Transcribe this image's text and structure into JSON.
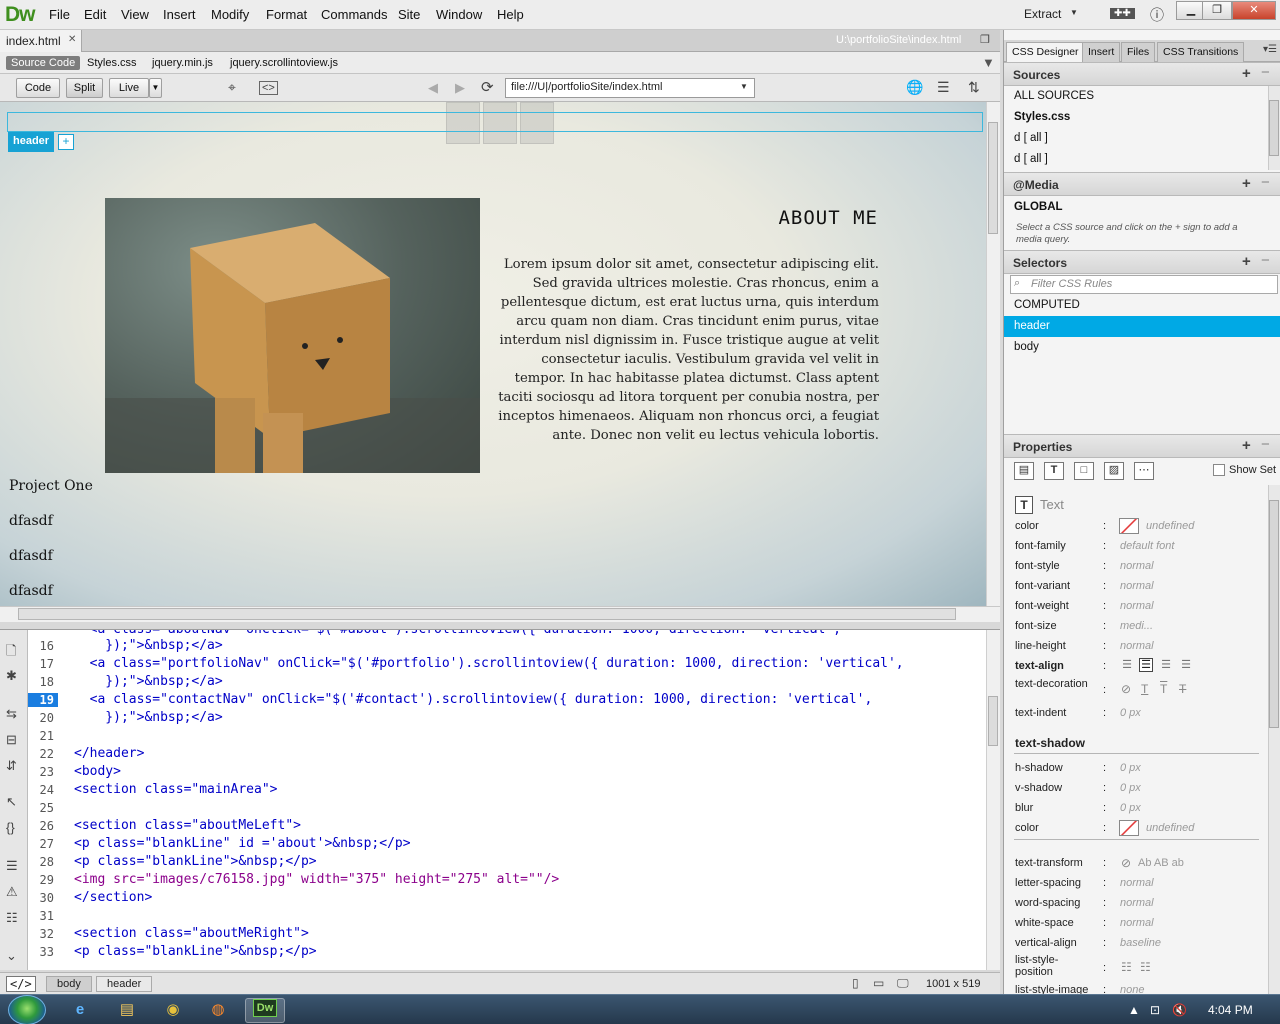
{
  "app": {
    "logo": "Dw",
    "menu": [
      "File",
      "Edit",
      "View",
      "Insert",
      "Modify",
      "Format",
      "Commands",
      "Site",
      "Window",
      "Help"
    ],
    "workspace": "Extract"
  },
  "document": {
    "tab": "index.html",
    "path": "U:\\portfolioSite\\index.html",
    "related_files": [
      "Source Code",
      "Styles.css",
      "jquery.min.js",
      "jquery.scrollintoview.js"
    ],
    "views": [
      "Code",
      "Split",
      "Live"
    ],
    "address": "file:///U|/portfolioSite/index.html"
  },
  "design": {
    "badge": "header",
    "badge_plus": "+",
    "about_title": "ABOUT ME",
    "about_text": "Lorem ipsum dolor sit amet, consectetur adipiscing elit. Sed gravida ultrices molestie. Cras rhoncus, enim a pellentesque dictum, est erat luctus urna, quis interdum arcu quam non diam. Cras tincidunt enim purus, vitae interdum nisl dignissim in. Fusce tristique augue at velit consectetur iaculis. Vestibulum gravida vel velit in tempor. In hac habitasse platea dictumst. Class aptent taciti sociosqu ad litora torquent per conubia nostra, per inceptos himenaeos. Aliquam non rhoncus orci, a feugiat ante. Donec non velit eu lectus vehicula lobortis.",
    "project_lines": [
      "Project One",
      "dfasdf",
      "dfasdf",
      "dfasdf"
    ]
  },
  "code": {
    "lines": [
      {
        "n": "16",
        "text": "    });\">&nbsp;</a>"
      },
      {
        "n": "",
        "text": "  <a class=\"portfolioNav\" onClick=\"$('#portfolio').scrollintoview({ duration: 1000, direction: 'vertical',"
      },
      {
        "n": "17",
        "text": "    });\">&nbsp;</a>"
      },
      {
        "n": "18",
        "text": "  <a class=\"contactNav\" onClick=\"$('#contact').scrollintoview({ duration: 1000, direction: 'vertical',"
      },
      {
        "n": "19",
        "text": "    });\">&nbsp;</a>"
      },
      {
        "n": "20",
        "text": ""
      },
      {
        "n": "21",
        "text": "</header>"
      },
      {
        "n": "22",
        "text": "<body>"
      },
      {
        "n": "23",
        "text": "<section class=\"mainArea\">"
      },
      {
        "n": "24",
        "text": ""
      },
      {
        "n": "25",
        "text": "<section class=\"aboutMeLeft\">"
      },
      {
        "n": "26",
        "text": "<p class=\"blankLine\" id ='about'>&nbsp;</p>"
      },
      {
        "n": "27",
        "text": "<p class=\"blankLine\">&nbsp;</p>"
      },
      {
        "n": "28",
        "text": "<img src=\"images/c76158.jpg\" width=\"375\" height=\"275\" alt=\"\"/>"
      },
      {
        "n": "29",
        "text": "</section>"
      },
      {
        "n": "30",
        "text": ""
      },
      {
        "n": "31",
        "text": "<section class=\"aboutMeRight\">"
      },
      {
        "n": "32",
        "text": "<p class=\"blankLine\">&nbsp;</p>"
      }
    ],
    "line_numbers": [
      "16",
      "17",
      "18",
      "19",
      "20",
      "21",
      "22",
      "23",
      "24",
      "25",
      "26",
      "27",
      "28",
      "29",
      "30",
      "31",
      "32",
      "33"
    ]
  },
  "status": {
    "tag_icon": "</>",
    "breadcrumbs": [
      "body",
      "header"
    ],
    "viewport": "1001 x 519"
  },
  "panel": {
    "tabs": [
      "CSS Designer",
      "Insert",
      "Files",
      "CSS Transitions"
    ],
    "sources": {
      "title": "Sources",
      "items": [
        "ALL SOURCES",
        "Styles.css",
        "d  [ all ]",
        "d  [ all ]"
      ]
    },
    "media": {
      "title": "@Media",
      "global": "GLOBAL",
      "hint": "Select a CSS source and click on the + sign to add a media query."
    },
    "selectors": {
      "title": "Selectors",
      "filter_placeholder": "Filter CSS Rules",
      "items": [
        "COMPUTED",
        "header",
        "body"
      ]
    },
    "properties": {
      "title": "Properties",
      "show_set": "Show Set",
      "text_section": "Text",
      "text_props": [
        {
          "name": "color",
          "value": "undefined"
        },
        {
          "name": "font-family",
          "value": "default font"
        },
        {
          "name": "font-style",
          "value": "normal"
        },
        {
          "name": "font-variant",
          "value": "normal"
        },
        {
          "name": "font-weight",
          "value": "normal"
        },
        {
          "name": "font-size",
          "value": "medi..."
        },
        {
          "name": "line-height",
          "value": "normal"
        },
        {
          "name": "text-align",
          "value": ""
        },
        {
          "name": "text-decoration",
          "value": ""
        },
        {
          "name": "text-indent",
          "value": "0 px"
        }
      ],
      "shadow_title": "text-shadow",
      "shadow_props": [
        {
          "name": "h-shadow",
          "value": "0 px"
        },
        {
          "name": "v-shadow",
          "value": "0 px"
        },
        {
          "name": "blur",
          "value": "0 px"
        },
        {
          "name": "color",
          "value": "undefined"
        }
      ],
      "more_props": [
        {
          "name": "text-transform",
          "value": "Ab  AB  ab"
        },
        {
          "name": "letter-spacing",
          "value": "normal"
        },
        {
          "name": "word-spacing",
          "value": "normal"
        },
        {
          "name": "white-space",
          "value": "normal"
        },
        {
          "name": "vertical-align",
          "value": "baseline"
        },
        {
          "name": "list-style-position",
          "value": ""
        },
        {
          "name": "list-style-image",
          "value": "none"
        }
      ]
    }
  },
  "taskbar": {
    "clock": "4:04 PM"
  },
  "colors": {
    "accent": "#00a9e5",
    "badge": "#17a2d4",
    "line_active": "#1a7de0",
    "tag_blue": "#0000c8"
  }
}
